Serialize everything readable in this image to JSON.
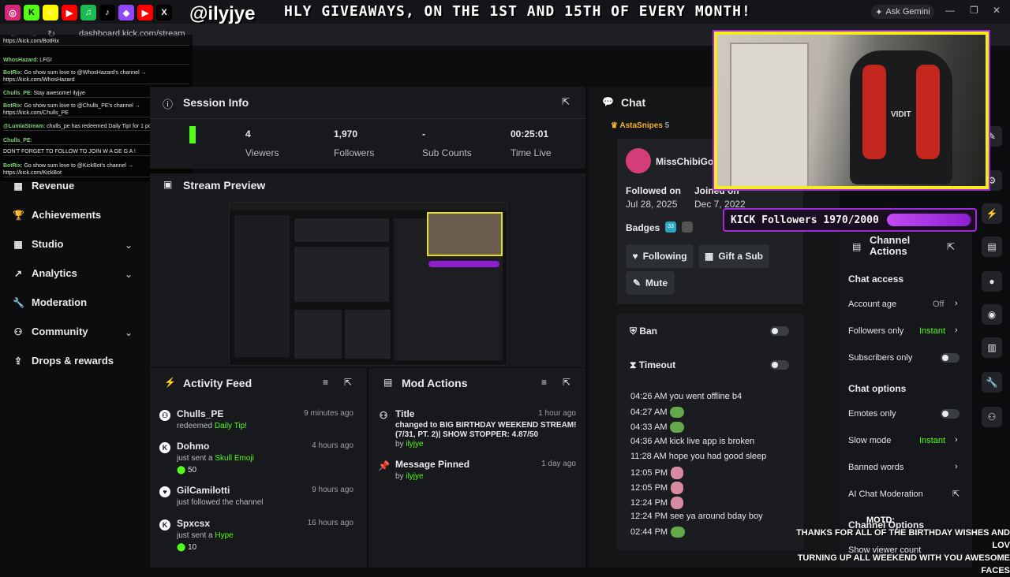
{
  "overlay": {
    "marquee": "HLY GIVEAWAYS, ON THE 1ST AND 15TH OF EVERY MONTH!",
    "handle": "@ilyjye",
    "social_icons": [
      "instagram-icon",
      "kick-icon",
      "snapchat-icon",
      "youtube-icon",
      "spotify-icon",
      "tiktok-icon",
      "twitch-icon",
      "youtube-icon",
      "x-icon"
    ],
    "followers_goal": {
      "label": "KICK Followers 1970/2000",
      "current": 1970,
      "target": 2000
    },
    "ticker": [
      "THANKS FOR ALL OF THE BIRTHDAY WISHES AND LOV",
      "TURNING UP ALL WEEKEND WITH YOU AWESOME FACES"
    ],
    "motd": "MOTD:"
  },
  "browser": {
    "url": "dashboard.kick.com/stream",
    "ask_gemini": "Ask Gemini"
  },
  "minichat": [
    {
      "name": "",
      "text": "https://kick.com/BotRix"
    },
    {
      "name": "WhosHazard",
      "text": ": LFG!"
    },
    {
      "name": "BotRix",
      "text": ": Go show sum love to @WhosHazard's channel → https://kick.com/WhosHazard"
    },
    {
      "name": "Chulls_PE",
      "text": ": Stay awesome! ilyjye"
    },
    {
      "name": "BotRix",
      "text": ": Go show sum love to @Chulls_PE's channel → https://kick.com/Chulls_PE"
    },
    {
      "name": "@LumiaStream",
      "text": ": chulls_pe has redeemed Daily Tip! for 1 points"
    },
    {
      "name": "Chulls_PE",
      "text": ":"
    },
    {
      "name": "",
      "text": "DON'T FORGET TO FOLLOW TO JOIN W A GE G A !"
    },
    {
      "name": "BotRix",
      "text": ": Go show sum love to @KickBot's channel → https://kick.com/KickBot"
    }
  ],
  "sidebar": {
    "items": [
      {
        "label": "Revenue",
        "icon": "revenue-icon",
        "chevron": false
      },
      {
        "label": "Achievements",
        "icon": "trophy-icon",
        "chevron": false
      },
      {
        "label": "Studio",
        "icon": "studio-icon",
        "chevron": true
      },
      {
        "label": "Analytics",
        "icon": "analytics-icon",
        "chevron": true
      },
      {
        "label": "Moderation",
        "icon": "wrench-icon",
        "chevron": false
      },
      {
        "label": "Community",
        "icon": "community-icon",
        "chevron": true
      },
      {
        "label": "Drops & rewards",
        "icon": "drops-icon",
        "chevron": false
      }
    ]
  },
  "session": {
    "title": "Session Info",
    "stats": [
      {
        "value": "4",
        "label": "Viewers"
      },
      {
        "value": "1,970",
        "label": "Followers"
      },
      {
        "value": "-",
        "label": "Sub Counts"
      },
      {
        "value": "00:25:01",
        "label": "Time Live"
      }
    ]
  },
  "preview": {
    "title": "Stream Preview"
  },
  "activity": {
    "title": "Activity Feed",
    "items": [
      {
        "name": "Chulls_PE",
        "time": "9 minutes ago",
        "desc": "redeemed",
        "highlight": "Daily Tip!",
        "sub": ""
      },
      {
        "name": "Dohmo",
        "time": "4 hours ago",
        "desc": "just sent a",
        "highlight": "Skull Emoji",
        "sub": "50"
      },
      {
        "name": "GilCamilotti",
        "time": "9 hours ago",
        "desc": "just followed the channel",
        "highlight": "",
        "sub": ""
      },
      {
        "name": "Spxcsx",
        "time": "16 hours ago",
        "desc": "just sent a",
        "highlight": "Hype",
        "sub": "10"
      }
    ]
  },
  "mod_actions": {
    "title": "Mod Actions",
    "items": [
      {
        "name": "Title",
        "time": "1 hour ago",
        "desc": "changed to BIG BIRTHDAY WEEKEND STREAM! (7/31, PT. 2)| SHOW STOPPER: 4.87/50",
        "by": "ilyjye"
      },
      {
        "name": "Message Pinned",
        "time": "1 day ago",
        "desc": "",
        "by": "ilyjye"
      }
    ]
  },
  "chat": {
    "title": "Chat",
    "top_user": "AstaSnipes",
    "top_count": "5",
    "user": {
      "name": "MissChibiGo",
      "followed_on_label": "Followed on",
      "followed_on": "Jul 28, 2025",
      "joined_on_label": "Joined on",
      "joined_on": "Dec 7, 2022",
      "badges_label": "Badges",
      "badge_count": "33",
      "following": "Following",
      "gift": "Gift a Sub",
      "mute": "Mute"
    },
    "ban": "Ban",
    "timeout": "Timeout",
    "history": [
      {
        "time": "04:26 AM",
        "text": "you went offline b4",
        "emote": ""
      },
      {
        "time": "04:27 AM",
        "text": "",
        "emote": "pepe"
      },
      {
        "time": "04:33 AM",
        "text": "",
        "emote": "pepe"
      },
      {
        "time": "04:36 AM",
        "text": "kick live app is broken",
        "emote": ""
      },
      {
        "time": "11:28 AM",
        "text": "hope you had good sleep",
        "emote": ""
      },
      {
        "time": "12:05 PM",
        "text": "",
        "emote": "cat"
      },
      {
        "time": "12:05 PM",
        "text": "",
        "emote": "cat"
      },
      {
        "time": "12:24 PM",
        "text": "",
        "emote": "cat"
      },
      {
        "time": "12:24 PM",
        "text": "see ya around bday boy",
        "emote": ""
      },
      {
        "time": "02:44 PM",
        "text": "",
        "emote": "pepe"
      }
    ]
  },
  "channel_actions": {
    "title_line1": "Channel",
    "title_line2": "Actions",
    "chat_access": "Chat access",
    "account_age": "Account age",
    "account_age_value": "Off",
    "followers_only": "Followers only",
    "followers_only_value": "Instant",
    "subscribers_only": "Subscribers only",
    "chat_options": "Chat options",
    "emotes_only": "Emotes only",
    "slow_mode": "Slow mode",
    "slow_mode_value": "Instant",
    "banned_words": "Banned words",
    "ai_moderation": "AI Chat Moderation",
    "channel_options": "Channel Options",
    "show_viewer_count": "Show viewer count"
  },
  "webcam": {
    "chair_brand": "VIDIT"
  }
}
